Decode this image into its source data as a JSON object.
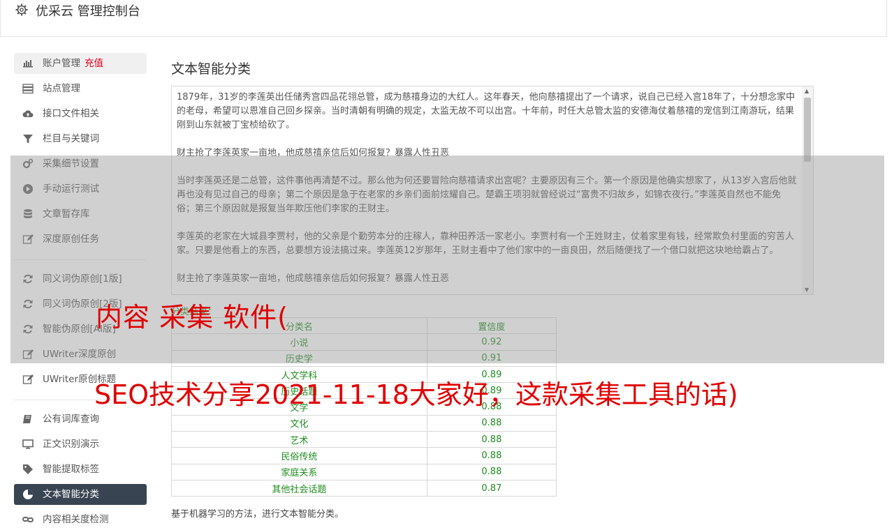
{
  "app": {
    "title": "优采云 管理控制台",
    "icon": "gear-icon"
  },
  "sidebar": {
    "group1": [
      {
        "label": "账户管理",
        "badge": "充值",
        "icon": "bar-chart-icon"
      },
      {
        "label": "站点管理",
        "icon": "server-icon"
      },
      {
        "label": "接口文件相关",
        "icon": "cloud-upload-icon"
      },
      {
        "label": "栏目与关键词",
        "icon": "filter-icon"
      },
      {
        "label": "采集细节设置",
        "icon": "cogs-icon"
      },
      {
        "label": "手动运行测试",
        "icon": "play-circle-icon"
      },
      {
        "label": "文章暂存库",
        "icon": "database-icon"
      },
      {
        "label": "深度原创任务",
        "icon": "edit-icon"
      }
    ],
    "group2": [
      {
        "label": "同义词伪原创[1版]",
        "icon": "refresh-icon"
      },
      {
        "label": "同义词伪原创[2版]",
        "icon": "refresh-icon"
      },
      {
        "label": "智能伪原创[AI版]",
        "icon": "refresh-icon"
      },
      {
        "label": "UWriter深度原创",
        "icon": "edit-icon"
      },
      {
        "label": "UWriter原创标题",
        "icon": "edit-icon"
      }
    ],
    "group3": [
      {
        "label": "公有词库查询",
        "icon": "book-icon"
      },
      {
        "label": "正文识别演示",
        "icon": "desktop-icon"
      },
      {
        "label": "智能提取标签",
        "icon": "tag-icon"
      },
      {
        "label": "文本智能分类",
        "icon": "pie-chart-icon"
      },
      {
        "label": "内容相关度检测",
        "icon": "link-icon"
      }
    ]
  },
  "main": {
    "title": "文本智能分类",
    "article": [
      "1879年，31岁的李莲英出任储秀宫四品花翎总管，成为慈禧身边的大红人。这年春天，他向慈禧提出了一个请求，说自己已经入宫18年了，十分想念家中的老母，希望可以恩准自己回乡探亲。当时清朝有明确的规定，太监无故不可以出宫。十年前，时任大总管太监的安德海仗着慈禧的宠信到江南游玩，结果刚到山东就被丁宝桢给砍了。",
      "财主抢了李莲英家一亩地，他成慈禧亲信后如何报复？暴露人性丑恶",
      "当时李莲英还是二总管，这件事他再清楚不过。那么他为何还要冒险向慈禧请求出宫呢？主要原因有三个。第一个原因是他确实想家了，从13岁入宫后他就再也没有见过自己的母亲；第二个原因是急于在老家的乡亲们面前炫耀自己。楚霸王项羽就曾经说过“富贵不归故乡，如锦衣夜行。”李莲英自然也不能免俗；第三个原因就是报复当年欺压他们李家的王财主。",
      "李莲英的老家在大城县李贾村，他的父亲是个勤劳本分的庄稼人，靠种田养活一家老小。李贾村有一个王姓财主，仗着家里有钱，经常欺负村里面的穷苦人家。只要是他看上的东西，总要想方设法搞过来。李莲英12岁那年，王财主看中了他们家中的一亩良田，然后随便找了一个借口就把这块地给霸占了。",
      "财主抢了李莲英家一亩地，他成慈禧亲信后如何报复？暴露人性丑恶"
    ],
    "result_caption": "分类结果：",
    "table": {
      "headers": [
        "分类名",
        "置信度"
      ],
      "rows": [
        [
          "小说",
          "0.92"
        ],
        [
          "历史学",
          "0.91"
        ],
        [
          "人文学科",
          "0.89"
        ],
        [
          "历史话题",
          "0.89"
        ],
        [
          "文学",
          "0.88"
        ],
        [
          "文化",
          "0.88"
        ],
        [
          "艺术",
          "0.88"
        ],
        [
          "民俗传统",
          "0.88"
        ],
        [
          "家庭关系",
          "0.88"
        ],
        [
          "其他社会话题",
          "0.87"
        ]
      ]
    },
    "footnote": "基于机器学习的方法，进行文本智能分类。"
  },
  "overlay": {
    "title": "内容 采集 软件(",
    "subtitle": "SEO技术分享2021-11-18大家好，这款采集工具的话)"
  }
}
